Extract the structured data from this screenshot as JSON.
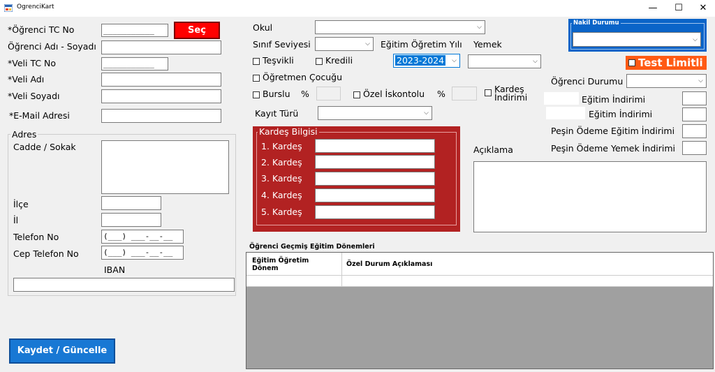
{
  "window": {
    "title": "OgrenciKart",
    "minimize": "—",
    "maximize": "☐",
    "close": "✕"
  },
  "left": {
    "ogrenci_tc_label": "*Öğrenci TC No",
    "ogrenci_tc_value": "___________",
    "sec_button": "Seç",
    "ogrenci_ad_label": "Öğrenci Adı - Soyadı",
    "veli_tc_label": "*Veli TC No",
    "veli_tc_value": "___________",
    "veli_adi_label": "*Veli Adı",
    "veli_soyadi_label": "*Veli Soyadı",
    "email_label": "*E-Mail  Adresi"
  },
  "adres": {
    "group_title": "Adres",
    "cadde_label": "Cadde / Sokak",
    "ilce_label": "İlçe",
    "il_label": "İl",
    "telefon_label": "Telefon No",
    "telefon_value": "(___) ___-__-__",
    "cep_label": "Cep Telefon No",
    "cep_value": "(___) ___-__-__",
    "iban_label": "IBAN"
  },
  "middle": {
    "okul_label": "Okul",
    "sinif_label": "Sınıf Seviyesi",
    "egitim_yili_label": "Eğitim Öğretim Yılı",
    "egitim_yili_value": "2023-2024",
    "yemek_label": "Yemek",
    "tesvikli_label": "Teşvikli",
    "kredili_label": "Kredili",
    "ogretmen_cocugu_label": "Öğretmen Çocuğu",
    "burslu_label": "Burslu",
    "burslu_pct": "%",
    "ozel_iskonto_label": "Özel İskontolu",
    "ozel_iskonto_pct": "%",
    "kardes_indirimi_label_1": "Kardeş",
    "kardes_indirimi_label_2": "İndirimi",
    "kayit_turu_label": "Kayıt Türü"
  },
  "kardes": {
    "title": "Kardeş Bilgisi",
    "items": [
      "1. Kardeş",
      "2. Kardeş",
      "3. Kardeş",
      "4. Kardeş",
      "5. Kardeş"
    ]
  },
  "right": {
    "nakil_title": "Nakil Durumu",
    "test_limitli_label": "Test Limitli",
    "ogrenci_durumu_label": "Öğrenci Durumu",
    "egitim_indirimi_1": "Eğitim İndirimi",
    "egitim_indirimi_2": "Eğitim İndirimi",
    "pesin_egitim_label": "Peşin Ödeme Eğitim İndirimi",
    "pesin_yemek_label": "Peşin Ödeme Yemek İndirimi",
    "aciklama_label": "Açıklama"
  },
  "gecmis": {
    "title": "Öğrenci Geçmiş Eğitim Dönemleri",
    "col1_line1": "Eğitim Öğretim",
    "col1_line2": "Dönem",
    "col2": "Özel Durum Açıklaması"
  },
  "save_button": "Kaydet / Güncelle",
  "icons": {
    "dropdown": "chevron-down-icon",
    "app": "app-window-icon"
  },
  "colors": {
    "sec_button": "#ff0000",
    "kardes_panel": "#b22222",
    "nakil_panel": "#0a64c8",
    "test_limitli": "#ff5a14",
    "save_button": "#1878d4"
  }
}
